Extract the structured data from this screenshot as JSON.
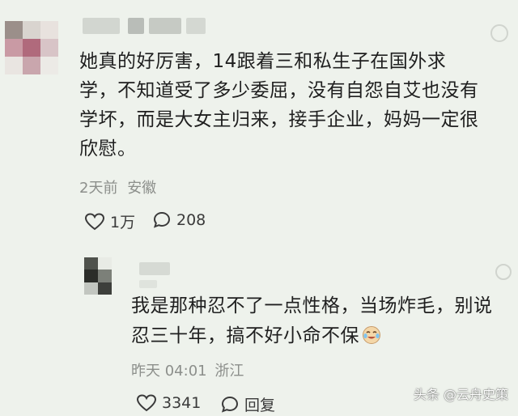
{
  "comment": {
    "text": "她真的好厉害，14跟着三和私生子在国外求学，不知道受了多少委屈，没有自怨自艾也没有学坏，而是大女主归来，接手企业，妈妈一定很欣慰。",
    "time": "2天前",
    "location": "安徽",
    "likes": "1万",
    "replies": "208"
  },
  "reply": {
    "text": "我是那种忍不了一点性格，当场炸毛，别说忍三十年，搞不好小命不保",
    "emoji": "crying-laughing-emoji",
    "time": "昨天 04:01",
    "location": "浙江",
    "likes": "3341",
    "reply_label": "回复"
  },
  "watermark": {
    "text": "头条 @云舟史策"
  },
  "icons": [
    "heart-icon",
    "comment-bubble-icon",
    "reply-bubble-icon"
  ],
  "colors": {
    "background": "#eef2ec",
    "text": "#1f1f1f",
    "meta": "#8c8f8b"
  }
}
